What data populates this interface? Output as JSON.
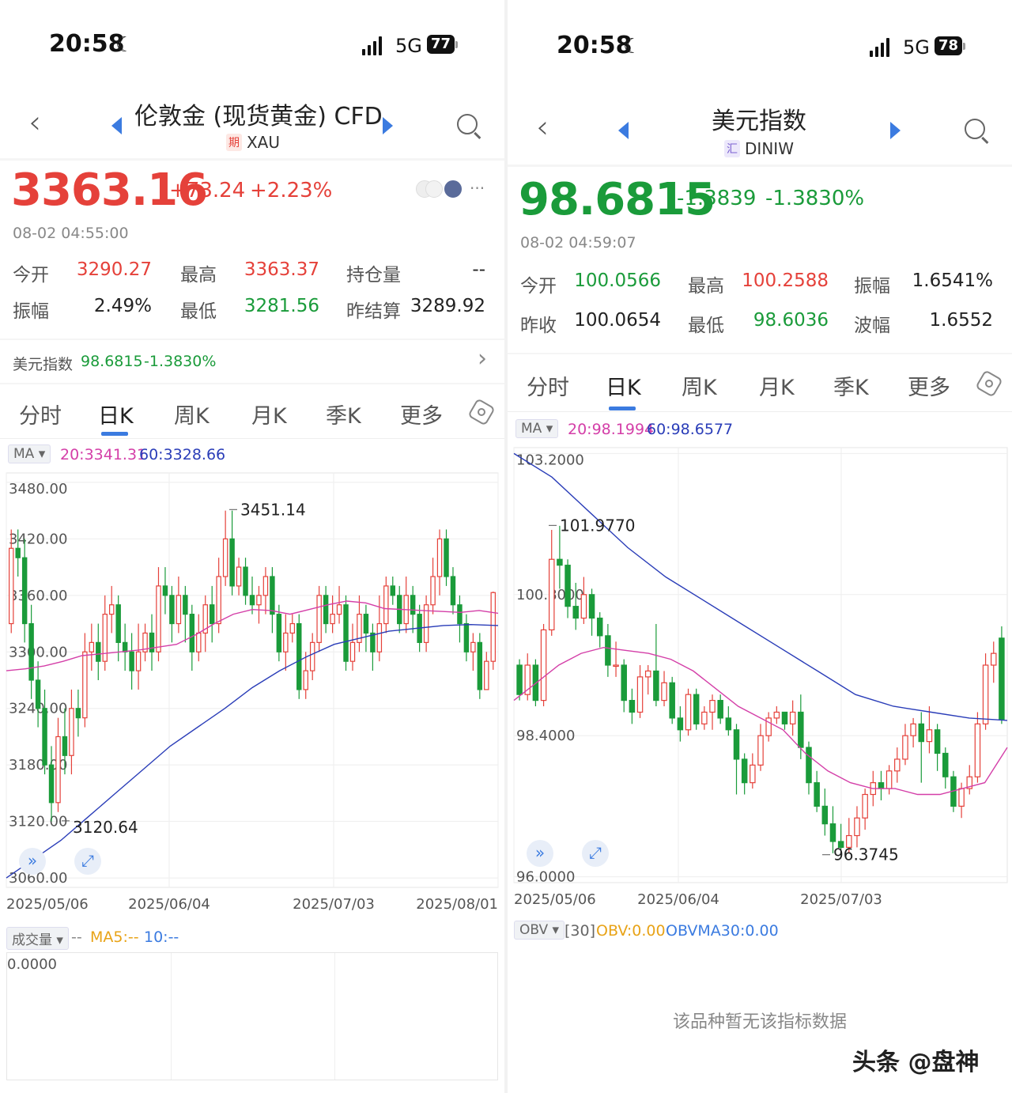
{
  "left": {
    "status": {
      "time": "20:58",
      "network": "5G",
      "battery": "77"
    },
    "header": {
      "title": "伦敦金 (现货黄金) CFD",
      "tag": "期",
      "code": "XAU"
    },
    "quote": {
      "price": "3363.16",
      "change": "+73.24",
      "change_pct": "+2.23%",
      "timestamp": "08-02 04:55:00",
      "more": "···"
    },
    "stats": [
      {
        "label": "今开",
        "value": "3290.27",
        "color": "red"
      },
      {
        "label": "最高",
        "value": "3363.37",
        "color": "red"
      },
      {
        "label": "持仓量",
        "value": "--",
        "color": "dark"
      },
      {
        "label": "振幅",
        "value": "2.49%",
        "color": "dark"
      },
      {
        "label": "最低",
        "value": "3281.56",
        "color": "green"
      },
      {
        "label": "昨结算",
        "value": "3289.92",
        "color": "dark"
      }
    ],
    "related": {
      "name": "美元指数",
      "value": "98.6815",
      "change": "-1.3830%"
    },
    "tabs": [
      "分时",
      "日K",
      "周K",
      "月K",
      "季K",
      "更多"
    ],
    "active_tab": "日K",
    "ma": {
      "chip": "MA",
      "ma20": "20:3341.31",
      "ma60": "60:3328.66"
    },
    "volume": {
      "chip": "成交量",
      "dash": "--",
      "ma5": "MA5:--",
      "ma10": "10:--",
      "zero": "0.0000"
    },
    "colors": {
      "up": "#e5413a",
      "down": "#1a9b3a",
      "ma20": "#d43fa8",
      "ma60": "#2a3db8",
      "accent": "#3b7be0"
    }
  },
  "right": {
    "status": {
      "time": "20:58",
      "network": "5G",
      "battery": "78"
    },
    "header": {
      "title": "美元指数",
      "tag": "汇",
      "code": "DINIW"
    },
    "quote": {
      "price": "98.6815",
      "change": "-1.3839",
      "change_pct": "-1.3830%",
      "timestamp": "08-02 04:59:07"
    },
    "stats": [
      {
        "label": "今开",
        "value": "100.0566",
        "color": "green"
      },
      {
        "label": "最高",
        "value": "100.2588",
        "color": "red"
      },
      {
        "label": "振幅",
        "value": "1.6541%",
        "color": "dark"
      },
      {
        "label": "昨收",
        "value": "100.0654",
        "color": "dark"
      },
      {
        "label": "最低",
        "value": "98.6036",
        "color": "green"
      },
      {
        "label": "波幅",
        "value": "1.6552",
        "color": "dark"
      }
    ],
    "tabs": [
      "分时",
      "日K",
      "周K",
      "月K",
      "季K",
      "更多"
    ],
    "active_tab": "日K",
    "ma": {
      "chip": "MA",
      "ma20": "20:98.1994",
      "ma60": "60:98.6577"
    },
    "obv": {
      "chip": "OBV",
      "period": "[30]",
      "obv": "OBV:0.00",
      "obvma": "OBVMA30:0.00",
      "empty_msg": "该品种暂无该指标数据"
    },
    "watermark": "头条 @盘神"
  },
  "chart_data": [
    {
      "type": "candlestick",
      "title": "伦敦金 (现货黄金) CFD 日K",
      "y_ticks": [
        "3480.00",
        "3420.00",
        "3360.00",
        "3300.00",
        "3240.00",
        "3180.00",
        "3120.00",
        "3060.00"
      ],
      "ylim": [
        3050,
        3490
      ],
      "x_ticks": [
        "2025/05/06",
        "2025/06/04",
        "2025/07/03",
        "2025/08/01"
      ],
      "annotations": {
        "high": "3451.14",
        "low": "3120.64"
      },
      "candles": [
        [
          3330,
          3410,
          3430,
          3320
        ],
        [
          3410,
          3400,
          3430,
          3380
        ],
        [
          3400,
          3330,
          3420,
          3310
        ],
        [
          3330,
          3270,
          3350,
          3250
        ],
        [
          3270,
          3240,
          3290,
          3220
        ],
        [
          3240,
          3180,
          3260,
          3170
        ],
        [
          3180,
          3140,
          3200,
          3120
        ],
        [
          3140,
          3210,
          3230,
          3130
        ],
        [
          3210,
          3190,
          3240,
          3170
        ],
        [
          3190,
          3240,
          3260,
          3170
        ],
        [
          3240,
          3230,
          3260,
          3210
        ],
        [
          3230,
          3300,
          3320,
          3220
        ],
        [
          3300,
          3310,
          3330,
          3280
        ],
        [
          3310,
          3290,
          3330,
          3270
        ],
        [
          3290,
          3340,
          3360,
          3280
        ],
        [
          3340,
          3350,
          3370,
          3320
        ],
        [
          3350,
          3310,
          3360,
          3290
        ],
        [
          3310,
          3300,
          3330,
          3280
        ],
        [
          3300,
          3280,
          3320,
          3260
        ],
        [
          3280,
          3300,
          3330,
          3260
        ],
        [
          3300,
          3320,
          3330,
          3290
        ],
        [
          3320,
          3300,
          3340,
          3280
        ],
        [
          3300,
          3370,
          3390,
          3290
        ],
        [
          3370,
          3360,
          3390,
          3340
        ],
        [
          3360,
          3330,
          3370,
          3310
        ],
        [
          3330,
          3360,
          3380,
          3320
        ],
        [
          3360,
          3340,
          3370,
          3310
        ],
        [
          3340,
          3300,
          3350,
          3280
        ],
        [
          3300,
          3320,
          3340,
          3290
        ],
        [
          3320,
          3350,
          3360,
          3300
        ],
        [
          3350,
          3330,
          3370,
          3310
        ],
        [
          3330,
          3380,
          3400,
          3320
        ],
        [
          3380,
          3420,
          3450,
          3370
        ],
        [
          3420,
          3370,
          3450,
          3360
        ],
        [
          3370,
          3390,
          3400,
          3360
        ],
        [
          3390,
          3360,
          3400,
          3350
        ],
        [
          3360,
          3350,
          3380,
          3340
        ],
        [
          3350,
          3360,
          3370,
          3330
        ],
        [
          3360,
          3380,
          3390,
          3340
        ],
        [
          3380,
          3340,
          3390,
          3320
        ],
        [
          3340,
          3300,
          3350,
          3290
        ],
        [
          3300,
          3320,
          3340,
          3280
        ],
        [
          3320,
          3330,
          3340,
          3310
        ],
        [
          3330,
          3260,
          3340,
          3250
        ],
        [
          3260,
          3280,
          3300,
          3250
        ],
        [
          3280,
          3310,
          3320,
          3270
        ],
        [
          3310,
          3360,
          3370,
          3300
        ],
        [
          3360,
          3330,
          3370,
          3320
        ],
        [
          3330,
          3340,
          3360,
          3320
        ],
        [
          3340,
          3350,
          3370,
          3330
        ],
        [
          3350,
          3290,
          3360,
          3280
        ],
        [
          3290,
          3310,
          3330,
          3280
        ],
        [
          3310,
          3340,
          3360,
          3300
        ],
        [
          3340,
          3320,
          3350,
          3300
        ],
        [
          3320,
          3300,
          3330,
          3280
        ],
        [
          3300,
          3330,
          3360,
          3290
        ],
        [
          3330,
          3370,
          3380,
          3320
        ],
        [
          3370,
          3360,
          3380,
          3350
        ],
        [
          3360,
          3330,
          3370,
          3320
        ],
        [
          3330,
          3360,
          3380,
          3320
        ],
        [
          3360,
          3340,
          3370,
          3320
        ],
        [
          3340,
          3310,
          3350,
          3300
        ],
        [
          3310,
          3350,
          3360,
          3300
        ],
        [
          3350,
          3380,
          3400,
          3340
        ],
        [
          3380,
          3420,
          3430,
          3360
        ],
        [
          3420,
          3380,
          3430,
          3370
        ],
        [
          3380,
          3350,
          3390,
          3340
        ],
        [
          3350,
          3330,
          3360,
          3310
        ],
        [
          3330,
          3300,
          3340,
          3290
        ],
        [
          3300,
          3310,
          3320,
          3280
        ],
        [
          3310,
          3260,
          3320,
          3250
        ],
        [
          3260,
          3290,
          3300,
          3260
        ],
        [
          3290,
          3363,
          3364,
          3281
        ]
      ],
      "ma20": [
        3280,
        3282,
        3285,
        3290,
        3296,
        3298,
        3300,
        3302,
        3305,
        3308,
        3318,
        3330,
        3340,
        3345,
        3344,
        3340,
        3345,
        3350,
        3354,
        3352,
        3346,
        3345,
        3344,
        3343,
        3342,
        3344,
        3341
      ],
      "ma60": [
        3060,
        3080,
        3100,
        3125,
        3150,
        3175,
        3200,
        3220,
        3240,
        3262,
        3280,
        3295,
        3308,
        3315,
        3322,
        3325,
        3328,
        3329,
        3328
      ]
    },
    {
      "type": "candlestick",
      "title": "美元指数 日K",
      "y_ticks": [
        "103.2000",
        "100.8000",
        "98.4000",
        "96.0000"
      ],
      "ylim": [
        95.9,
        103.3
      ],
      "x_ticks": [
        "2025/05/06",
        "2025/06/04",
        "2025/07/03"
      ],
      "annotations": {
        "high": "101.9770",
        "low": "96.3745"
      },
      "candles": [
        [
          99.6,
          99.1,
          99.7,
          99.0
        ],
        [
          99.1,
          99.6,
          99.8,
          99.0
        ],
        [
          99.6,
          99.0,
          99.7,
          98.9
        ],
        [
          99.0,
          100.2,
          100.3,
          98.9
        ],
        [
          100.2,
          101.4,
          101.9,
          100.1
        ],
        [
          101.4,
          101.3,
          101.97,
          100.9
        ],
        [
          101.3,
          100.6,
          101.4,
          100.4
        ],
        [
          100.6,
          100.4,
          101.0,
          100.2
        ],
        [
          100.4,
          100.8,
          101.1,
          100.3
        ],
        [
          100.8,
          100.4,
          100.9,
          100.1
        ],
        [
          100.4,
          100.1,
          100.5,
          99.9
        ],
        [
          100.1,
          99.6,
          100.3,
          99.4
        ],
        [
          99.6,
          99.6,
          100.0,
          99.4
        ],
        [
          99.6,
          99.0,
          99.7,
          98.8
        ],
        [
          99.0,
          98.8,
          99.2,
          98.6
        ],
        [
          98.8,
          99.4,
          99.6,
          98.7
        ],
        [
          99.4,
          99.5,
          99.6,
          99.1
        ],
        [
          99.5,
          99.0,
          100.3,
          98.9
        ],
        [
          99.0,
          99.3,
          99.5,
          98.9
        ],
        [
          99.3,
          98.7,
          99.4,
          98.6
        ],
        [
          98.7,
          98.5,
          98.9,
          98.3
        ],
        [
          98.5,
          99.1,
          99.2,
          98.4
        ],
        [
          99.1,
          98.6,
          99.2,
          98.5
        ],
        [
          98.6,
          98.8,
          98.9,
          98.5
        ],
        [
          98.8,
          99.0,
          99.1,
          98.5
        ],
        [
          99.0,
          98.7,
          99.1,
          98.6
        ],
        [
          98.7,
          98.5,
          98.9,
          98.4
        ],
        [
          98.5,
          98.0,
          98.6,
          97.4
        ],
        [
          98.0,
          97.6,
          98.1,
          97.4
        ],
        [
          97.6,
          97.9,
          98.1,
          97.5
        ],
        [
          97.9,
          98.4,
          98.6,
          97.8
        ],
        [
          98.4,
          98.7,
          98.8,
          98.3
        ],
        [
          98.7,
          98.8,
          98.9,
          98.6
        ],
        [
          98.8,
          98.6,
          98.8,
          98.5
        ],
        [
          98.6,
          98.8,
          99.0,
          98.4
        ],
        [
          98.8,
          98.2,
          99.1,
          98.0
        ],
        [
          98.2,
          97.6,
          98.3,
          97.4
        ],
        [
          97.6,
          97.2,
          97.8,
          97.1
        ],
        [
          97.2,
          96.9,
          97.5,
          96.7
        ],
        [
          96.9,
          96.6,
          97.2,
          96.4
        ],
        [
          96.6,
          96.5,
          96.9,
          96.37
        ],
        [
          96.5,
          96.7,
          97.0,
          96.4
        ],
        [
          96.7,
          97.0,
          97.2,
          96.5
        ],
        [
          97.0,
          97.4,
          97.5,
          96.8
        ],
        [
          97.4,
          97.6,
          97.8,
          97.2
        ],
        [
          97.6,
          97.5,
          97.8,
          97.3
        ],
        [
          97.5,
          97.8,
          97.9,
          97.4
        ],
        [
          97.8,
          98.0,
          98.2,
          97.6
        ],
        [
          98.0,
          98.4,
          98.6,
          97.9
        ],
        [
          98.4,
          98.6,
          98.7,
          98.2
        ],
        [
          98.6,
          98.3,
          98.8,
          97.6
        ],
        [
          98.3,
          98.5,
          98.9,
          98.1
        ],
        [
          98.5,
          98.1,
          98.6,
          97.8
        ],
        [
          98.1,
          97.7,
          98.2,
          97.5
        ],
        [
          97.7,
          97.2,
          97.8,
          97.1
        ],
        [
          97.2,
          97.5,
          97.6,
          97.0
        ],
        [
          97.5,
          97.7,
          97.9,
          97.4
        ],
        [
          97.7,
          98.6,
          98.8,
          97.6
        ],
        [
          98.6,
          99.6,
          99.8,
          98.5
        ],
        [
          99.6,
          99.8,
          100.0,
          99.3
        ],
        [
          100.06,
          98.68,
          100.26,
          98.6
        ]
      ],
      "ma20": [
        99.0,
        99.3,
        99.6,
        99.8,
        99.9,
        99.85,
        99.8,
        99.7,
        99.5,
        99.2,
        98.9,
        98.7,
        98.5,
        98.1,
        97.8,
        97.6,
        97.5,
        97.5,
        97.4,
        97.4,
        97.5,
        97.6,
        98.2
      ],
      "ma60": [
        103.2,
        102.8,
        102.2,
        101.6,
        101.1,
        100.7,
        100.3,
        99.9,
        99.5,
        99.1,
        98.9,
        98.8,
        98.7,
        98.66
      ]
    }
  ]
}
